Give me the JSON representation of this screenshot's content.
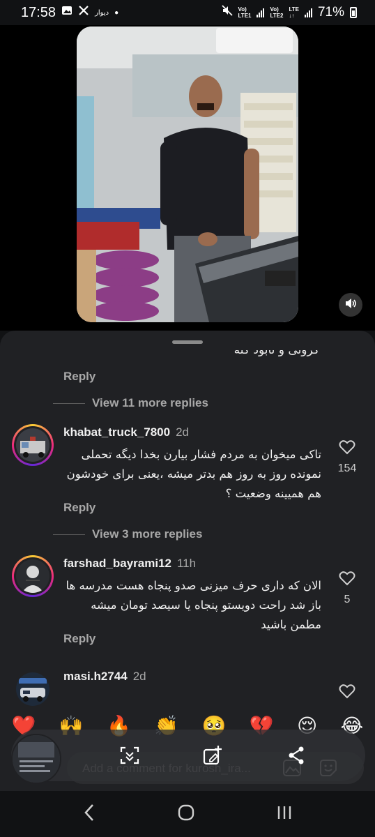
{
  "status_bar": {
    "time": "17:58",
    "app_label": "دیوار",
    "net1": [
      "Vo)",
      "LTE1"
    ],
    "net2": [
      "Vo)",
      "LTE2"
    ],
    "net_type": "LTE",
    "battery": "71%"
  },
  "comments_sheet": {
    "clipped_text": "کرونی و نابود کنه",
    "reply_label": "Reply",
    "view_more_1": "View 11 more replies",
    "view_more_2": "View 3 more replies",
    "comments": [
      {
        "username": "khabat_truck_7800",
        "time": "2d",
        "text": "تاکی میخوان به مردم فشار بیارن بخدا دیگه تحملی نمونده روز به روز هم بدتر میشه ،یعنی برای خودشون هم همیینه وضعیت ؟",
        "likes": "154"
      },
      {
        "username": "farshad_bayrami12",
        "time": "11h",
        "text": "الان که داری حرف میزنی صدو پنجاه هست مدرسه ها باز شد راحت دویستو پنجاه یا سیصد تومان میشه مطمن باشید",
        "likes": "5"
      },
      {
        "username": "masi.h2744",
        "time": "2d",
        "text": "",
        "likes": ""
      }
    ]
  },
  "emoji_bar": [
    "❤️",
    "🙌",
    "🔥",
    "👏",
    "🥺",
    "💔",
    "😌",
    "😂"
  ],
  "composer": {
    "placeholder": "Add a comment for kurosh_ira..."
  },
  "icons": {
    "mute": "speaker-icon",
    "like": "heart-icon",
    "scan": "scan-icon",
    "add_post": "add-post-icon",
    "share": "share-icon",
    "gallery": "gallery-icon",
    "sticker": "sticker-icon",
    "nav_back": "back-icon",
    "nav_home": "home-icon",
    "nav_recents": "recents-icon"
  }
}
